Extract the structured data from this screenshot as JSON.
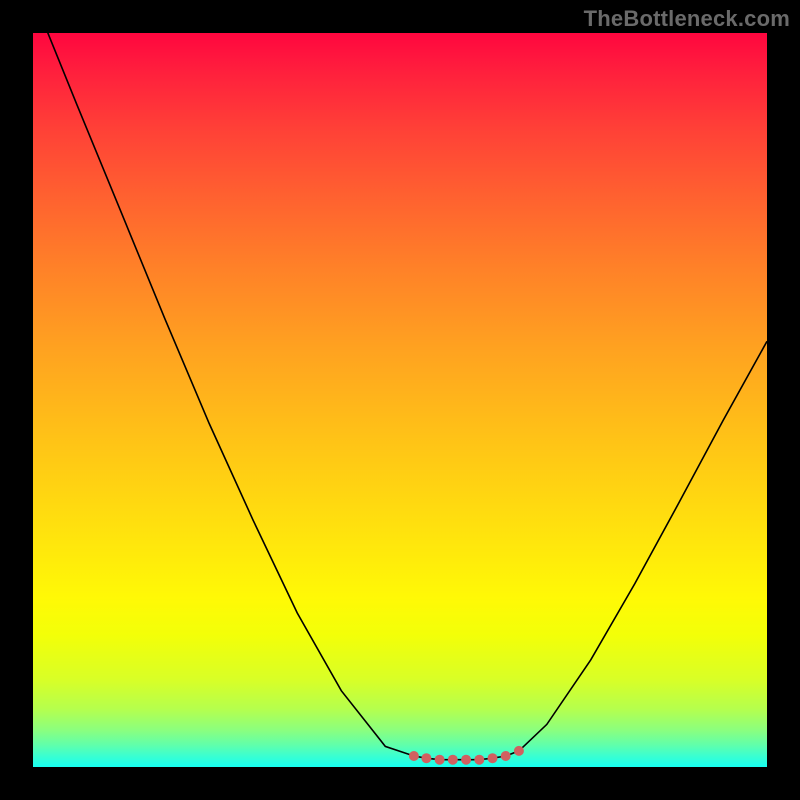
{
  "watermark": "TheBottleneck.com",
  "chart_data": {
    "type": "line",
    "title": "",
    "xlabel": "",
    "ylabel": "",
    "xlim": [
      0,
      1
    ],
    "ylim": [
      0,
      1
    ],
    "series": [
      {
        "name": "curve",
        "x": [
          0.0,
          0.06,
          0.12,
          0.18,
          0.24,
          0.3,
          0.36,
          0.42,
          0.48,
          0.519,
          0.536,
          0.554,
          0.572,
          0.59,
          0.608,
          0.626,
          0.644,
          0.662,
          0.7,
          0.76,
          0.82,
          0.88,
          0.94,
          1.0
        ],
        "y": [
          1.05,
          0.902,
          0.756,
          0.61,
          0.468,
          0.336,
          0.21,
          0.104,
          0.028,
          0.015,
          0.012,
          0.01,
          0.01,
          0.01,
          0.01,
          0.012,
          0.015,
          0.022,
          0.058,
          0.146,
          0.25,
          0.36,
          0.472,
          0.58
        ]
      }
    ],
    "bottom_markers": {
      "x": [
        0.519,
        0.536,
        0.554,
        0.572,
        0.59,
        0.608,
        0.626,
        0.644,
        0.662
      ],
      "y": [
        0.015,
        0.012,
        0.01,
        0.01,
        0.01,
        0.01,
        0.012,
        0.015,
        0.022
      ],
      "color": "#d16060",
      "radius": 5
    },
    "colors": {
      "curve": "#000000",
      "marker": "#d16060",
      "gradient_top": "#ff063f",
      "gradient_bottom": "#17fff2"
    }
  }
}
